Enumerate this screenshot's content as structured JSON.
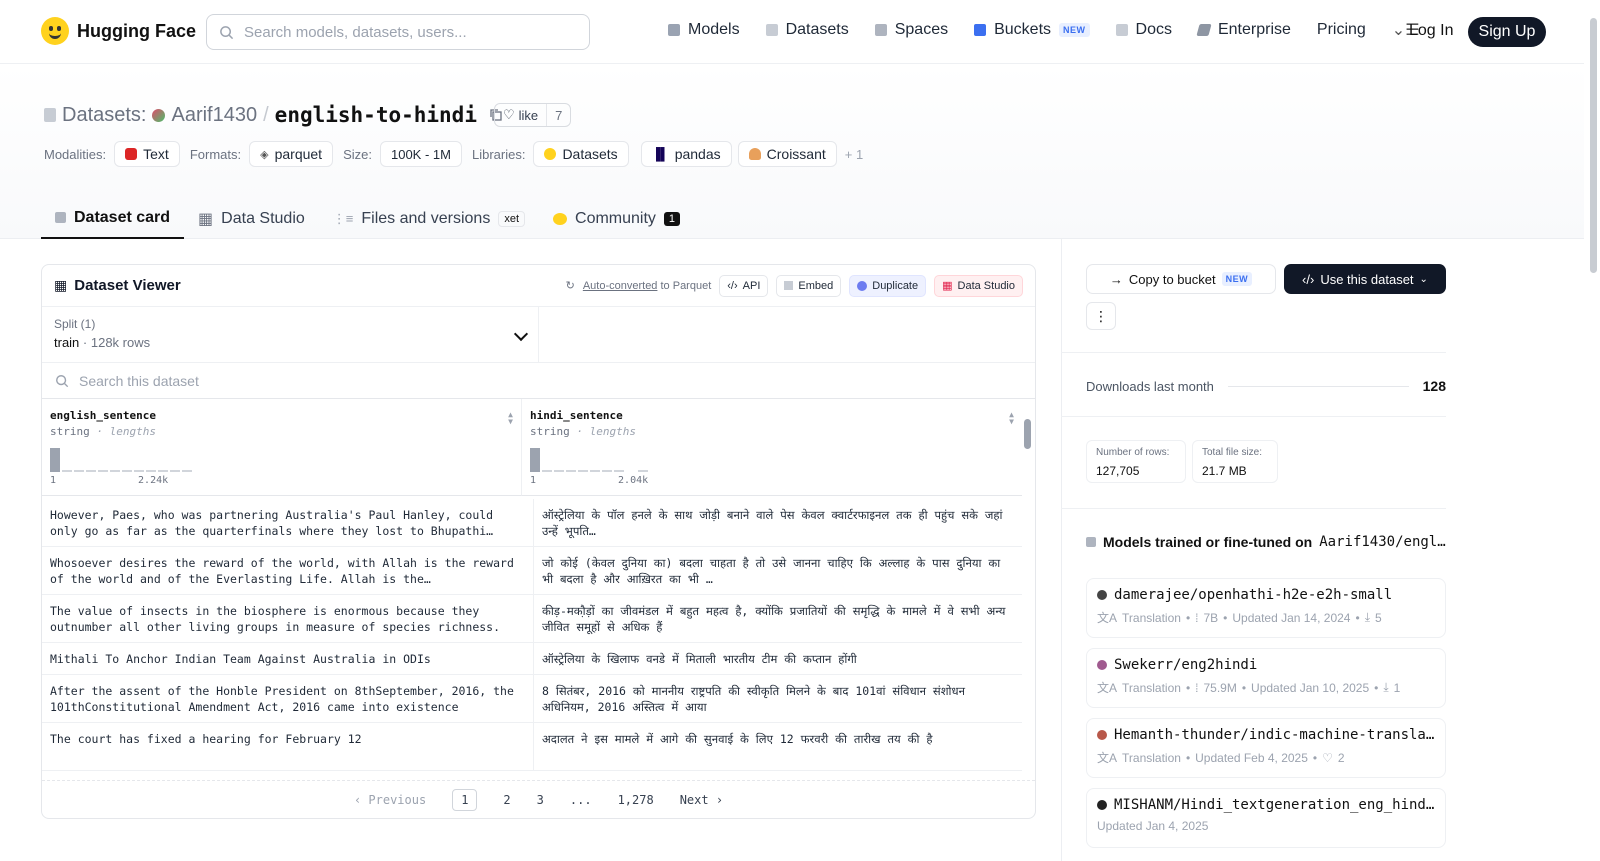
{
  "nav": {
    "brand": "Hugging Face",
    "search_placeholder": "Search models, datasets, users...",
    "links": [
      "Models",
      "Datasets",
      "Spaces",
      "Buckets",
      "Docs",
      "Enterprise",
      "Pricing"
    ],
    "new_badge": "NEW",
    "login": "Log In",
    "signup": "Sign Up"
  },
  "header": {
    "section": "Datasets:",
    "owner": "Aarif1430",
    "sep": "/",
    "name": "english-to-hindi",
    "like_label": "like",
    "like_count": "7",
    "modalities_label": "Modalities:",
    "modality": "Text",
    "formats_label": "Formats:",
    "format": "parquet",
    "size_label": "Size:",
    "size": "100K - 1M",
    "libraries_label": "Libraries:",
    "libraries": [
      "Datasets",
      "pandas",
      "Croissant"
    ],
    "more": "+ 1"
  },
  "tabs": {
    "card": "Dataset card",
    "studio": "Data Studio",
    "files": "Files and versions",
    "xet": "xet",
    "community": "Community",
    "community_count": "1"
  },
  "viewer": {
    "title": "Dataset Viewer",
    "auto": "Auto-converted",
    "to_parquet": "to Parquet",
    "api": "API",
    "embed": "Embed",
    "duplicate": "Duplicate",
    "data_studio": "Data Studio",
    "split_label": "Split (1)",
    "split_value": "train",
    "split_rows": "· 128k rows",
    "search_placeholder": "Search this dataset",
    "col1": {
      "name": "english_sentence",
      "type": "string",
      "sub": "· lengths",
      "min": "1",
      "max": "2.24k"
    },
    "col2": {
      "name": "hindi_sentence",
      "type": "string",
      "sub": "· lengths",
      "min": "1",
      "max": "2.04k"
    },
    "rows": [
      {
        "en": "However, Paes, who was partnering Australia's Paul Hanley, could only go as far as the quarterfinals where they lost to Bhupathi…",
        "hi": "ऑस्ट्रेलिया के पॉल हनले के साथ जोड़ी बनाने वाले पेस केवल क्वार्टरफाइनल तक ही पहुंच सके जहां उन्हें भूपति…"
      },
      {
        "en": "Whosoever desires the reward of the world, with Allah is the reward of the world and of the Everlasting Life. Allah is the…",
        "hi": "जो कोई (केवल दुनिया का) बदला चाहता है तो उसे जानना चाहिए कि अल्लाह के पास दुनिया का भी बदला है और आख़िरत का भी …"
      },
      {
        "en": "The value of insects in the biosphere is enormous because they outnumber all other living groups in measure of species richness.",
        "hi": "कीड़-मकौ़ड़ों का जीवमंडल में बहुत महत्व है, क्योंकि प्रजातियों की समृद्धि के मामले में वे सभी अन्य जीवित समूहों से अधिक हैं"
      },
      {
        "en": "Mithali To Anchor Indian Team Against Australia in ODIs",
        "hi": "ऑस्ट्रेलिया के खिलाफ वनडे में मिताली भारतीय टीम की कप्तान होंगी"
      },
      {
        "en": "After the assent of the Honble President on 8thSeptember, 2016, the 101thConstitutional Amendment Act, 2016 came into existence",
        "hi": "8 सितंबर, 2016 को माननीय राष्ट्रपति की स्वीकृति मिलने के बाद 101वां संविधान संशोधन अधिनियम, 2016 अस्तित्व में आया"
      },
      {
        "en": "The court has fixed a hearing for February 12",
        "hi": "अदालत ने इस मामले में आगे की सुनवाई के लिए 12 फरवरी की तारीख तय की है"
      }
    ],
    "pager": {
      "prev": "Previous",
      "pages": [
        "1",
        "2",
        "3",
        "...",
        "1,278"
      ],
      "next": "Next"
    }
  },
  "sidebar": {
    "copy": "Copy to bucket",
    "new_badge": "NEW",
    "use": "Use this dataset",
    "more": "⋮",
    "downloads_label": "Downloads last month",
    "downloads": "128",
    "rows_label": "Number of rows:",
    "rows": "127,705",
    "size_label": "Total file size:",
    "size": "21.7 MB",
    "models_title": "Models trained or fine-tuned on",
    "models_ds": "Aarif1430/engl…",
    "models": [
      {
        "name": "damerajee/openhathi-h2e-e2h-small",
        "task": "Translation",
        "params": "7B",
        "updated": "Updated Jan 14, 2024",
        "stat": "5",
        "avatar": "#444"
      },
      {
        "name": "Swekerr/eng2hindi",
        "task": "Translation",
        "params": "75.9M",
        "updated": "Updated Jan 10, 2025",
        "stat": "1",
        "avatar": "#a05a8f"
      },
      {
        "name": "Hemanth-thunder/indic-machine-transla…",
        "task": "Translation",
        "params": "",
        "updated": "Updated Feb 4, 2025",
        "stat": "2",
        "avatar": "#b8584a"
      },
      {
        "name": "MISHANM/Hindi_textgeneration_eng_hind…",
        "task": "",
        "params": "",
        "updated": "Updated Jan 4, 2025",
        "stat": "",
        "avatar": "#222"
      }
    ]
  }
}
